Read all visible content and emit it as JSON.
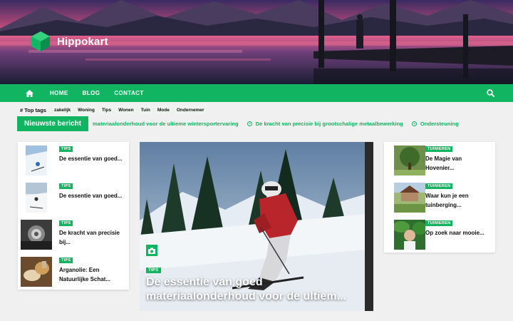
{
  "site": {
    "name": "Hippokart"
  },
  "nav": {
    "items": [
      {
        "label": "HOME"
      },
      {
        "label": "BLOG"
      },
      {
        "label": "CONTACT"
      }
    ]
  },
  "top_tags": {
    "label": "# Top tags",
    "tags": [
      "zakelijk",
      "Woning",
      "Tips",
      "Wonen",
      "Tuin",
      "Mode",
      "Ondernemer"
    ]
  },
  "ticker": {
    "label": "Nieuwste bericht",
    "items": [
      "materiaalonderhoud voor de ultieme wintersportervaring",
      "De kracht van precisie bij grootschalige metaalbewerking",
      "Ondersteuning"
    ]
  },
  "left_posts": [
    {
      "category": "TIPS",
      "title": "De essentie van goed..."
    },
    {
      "category": "TIPS",
      "title": "De essentie van goed..."
    },
    {
      "category": "TIPS",
      "title": "De kracht van precisie bij..."
    },
    {
      "category": "TIPS",
      "title": "Arganolie: Een Natuurlijke Schat..."
    }
  ],
  "featured": {
    "category": "TIPS",
    "title": "De essentie van goed materiaalonderhoud voor de ultiem..."
  },
  "right_posts": [
    {
      "category": "TUINIEREN",
      "title": "De Magie van Hovenier..."
    },
    {
      "category": "TUINIEREN",
      "title": "Waar kun je een tuinberging..."
    },
    {
      "category": "TUINIEREN",
      "title": "Op zoek naar mooie..."
    }
  ],
  "colors": {
    "accent": "#10b461"
  }
}
